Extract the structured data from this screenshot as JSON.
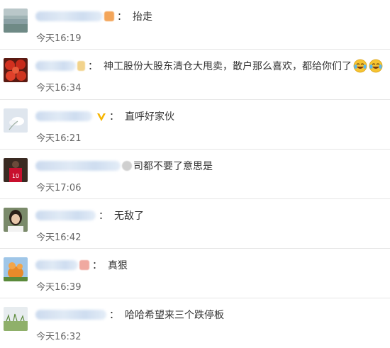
{
  "comments": [
    {
      "text": "抬走",
      "time": "今天16:19",
      "avatar": "lake-landscape-avatar",
      "badge_color": "#f3a55a",
      "name_width": 95
    },
    {
      "text": "神工股份大股东清仓大甩卖，散户那么喜欢，都给你们了",
      "time": "今天16:34",
      "avatar": "tomatoes-avatar",
      "badge_color": "#f2d38c",
      "name_width": 70
    },
    {
      "text": "直呼好家伙",
      "time": "今天16:21",
      "avatar": "white-flower-avatar",
      "badge_color": "#f6b400",
      "name_width": 80
    },
    {
      "text": "司都不要了意思是",
      "time": "今天17:06",
      "avatar": "soccer-player-avatar",
      "badge_color": "#cfcfcf",
      "name_width": 120
    },
    {
      "text": "无敌了",
      "time": "今天16:42",
      "avatar": "woman-portrait-avatar",
      "badge_color": "",
      "name_width": 85
    },
    {
      "text": "真狠",
      "time": "今天16:39",
      "avatar": "orange-cartoon-avatar",
      "badge_color": "#f0a9a0",
      "name_width": 60
    },
    {
      "text": "哈哈希望来三个跌停板",
      "time": "今天16:32",
      "avatar": "grass-avatar",
      "badge_color": "",
      "name_width": 100
    }
  ],
  "emoji_icons": [
    "laughing-tears-emoji",
    "laughing-tears-emoji"
  ],
  "colon": "："
}
